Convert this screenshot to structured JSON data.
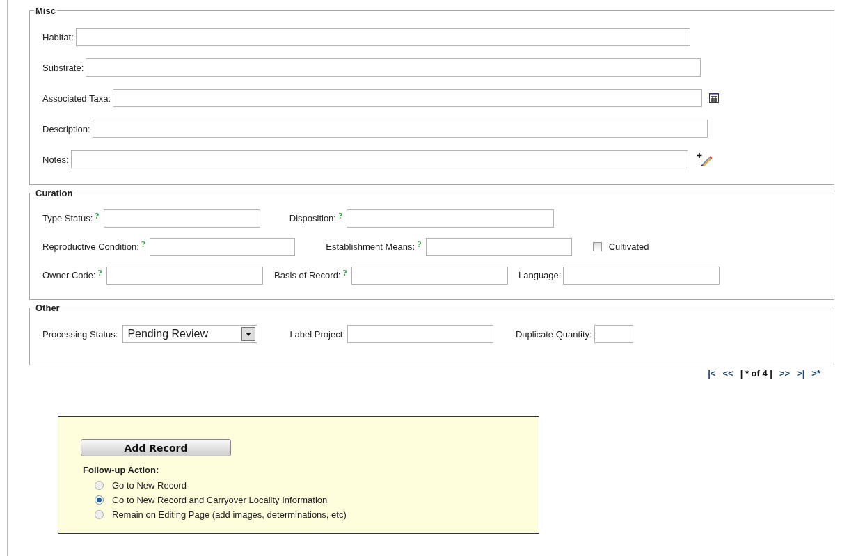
{
  "misc": {
    "legend": "Misc",
    "fields": [
      {
        "label": "Habitat:",
        "kind": "plain"
      },
      {
        "label": "Substrate:",
        "kind": "plain"
      },
      {
        "label": "Associated Taxa:",
        "kind": "lookup"
      },
      {
        "label": "Description:",
        "kind": "plain"
      },
      {
        "label": "Notes:",
        "kind": "notes"
      }
    ]
  },
  "curation": {
    "legend": "Curation",
    "rows": [
      [
        {
          "kind": "field",
          "label": "Type Status:",
          "help": "?"
        },
        {
          "kind": "field",
          "label": "Disposition:",
          "help": "?"
        }
      ],
      [
        {
          "kind": "field",
          "label": "Reproductive Condition:",
          "help": "?"
        },
        {
          "kind": "field",
          "label": "Establishment Means:",
          "help": "?"
        },
        {
          "kind": "checkbox",
          "label": "Cultivated",
          "checked": false
        }
      ],
      [
        {
          "kind": "field",
          "label": "Owner Code:",
          "help": "?"
        },
        {
          "kind": "field",
          "label": "Basis of Record:",
          "help": "?"
        },
        {
          "kind": "field",
          "label": "Language:"
        }
      ]
    ]
  },
  "other": {
    "legend": "Other",
    "items": [
      {
        "kind": "select",
        "label": "Processing Status:",
        "value": "Pending Review"
      },
      {
        "kind": "field",
        "label": "Label Project:"
      },
      {
        "kind": "small",
        "label": "Duplicate Quantity:"
      }
    ]
  },
  "pager": [
    {
      "kind": "link",
      "text": "|<"
    },
    {
      "kind": "link",
      "text": "<<"
    },
    {
      "kind": "text",
      "text": "| * of 4 |"
    },
    {
      "kind": "link",
      "text": ">>"
    },
    {
      "kind": "link",
      "text": ">|"
    },
    {
      "kind": "link",
      "text": ">*"
    }
  ],
  "add_panel": {
    "button": "Add Record",
    "heading": "Follow-up Action:",
    "options": [
      {
        "label": "Go to New Record",
        "selected": false
      },
      {
        "label": "Go to New Record and Carryover Locality Information",
        "selected": true
      },
      {
        "label": "Remain on Editing Page (add images, determinations, etc)",
        "selected": false
      }
    ]
  }
}
